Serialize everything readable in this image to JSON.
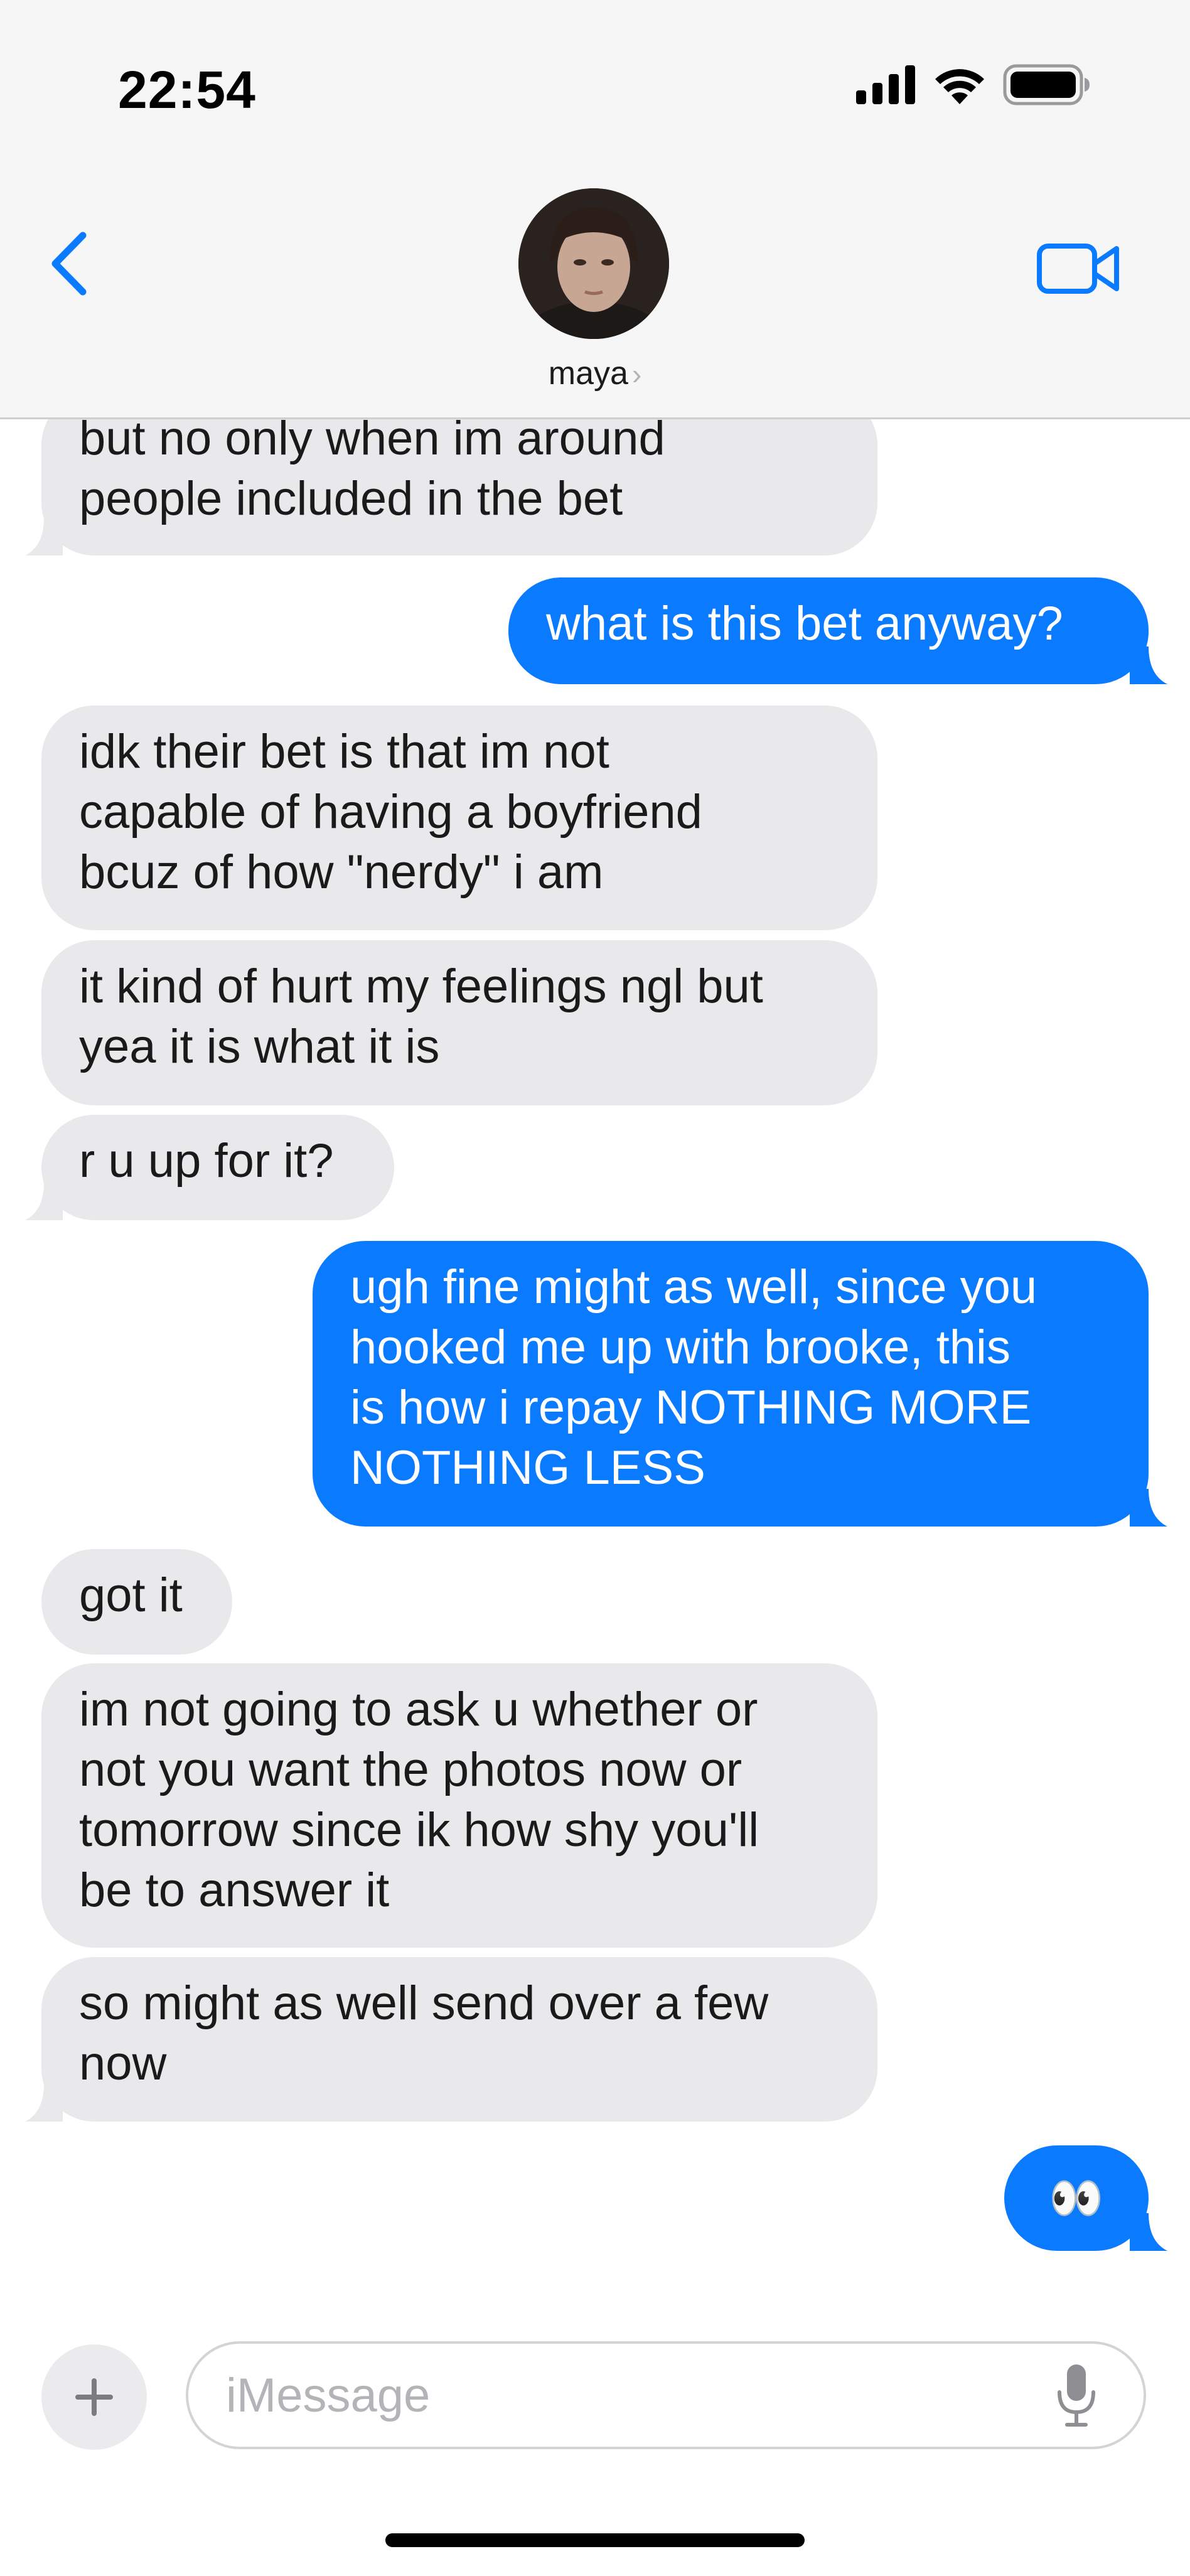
{
  "status_bar": {
    "time": "22:54",
    "icons": [
      "signal-icon",
      "wifi-icon",
      "battery-icon"
    ]
  },
  "header": {
    "contact_name": "maya",
    "back_icon": "chevron-left-icon",
    "video_icon": "video-camera-icon"
  },
  "colors": {
    "accent": "#0a7aff",
    "incoming_bubble": "#e9e9eb",
    "header_bg": "#f6f6f6"
  },
  "messages": [
    {
      "dir": "in",
      "lines": [
        "but no only when im around",
        "people included in the bet"
      ]
    },
    {
      "dir": "out",
      "lines": [
        "what is this bet anyway?"
      ]
    },
    {
      "dir": "in",
      "lines": [
        "idk their bet is that im not",
        "capable of having a boyfriend",
        "bcuz of how \"nerdy\" i am"
      ]
    },
    {
      "dir": "in",
      "lines": [
        "it kind of hurt my feelings ngl but",
        "yea it is what it is"
      ]
    },
    {
      "dir": "in",
      "lines": [
        "r u up for it?"
      ]
    },
    {
      "dir": "out",
      "lines": [
        "ugh fine might as well, since you",
        "hooked me up with brooke, this",
        "is how i repay NOTHING MORE",
        "NOTHING LESS"
      ]
    },
    {
      "dir": "in",
      "lines": [
        "got it"
      ]
    },
    {
      "dir": "in",
      "lines": [
        "im not going to ask u whether or",
        "not you want the photos now or",
        "tomorrow since ik how shy you'll",
        "be to answer it"
      ]
    },
    {
      "dir": "in",
      "lines": [
        "so might as well send over a few",
        "now"
      ]
    },
    {
      "dir": "out",
      "emoji": "👀",
      "lines": []
    }
  ],
  "composer": {
    "placeholder": "iMessage",
    "plus_icon": "plus-icon",
    "mic_icon": "microphone-icon"
  }
}
